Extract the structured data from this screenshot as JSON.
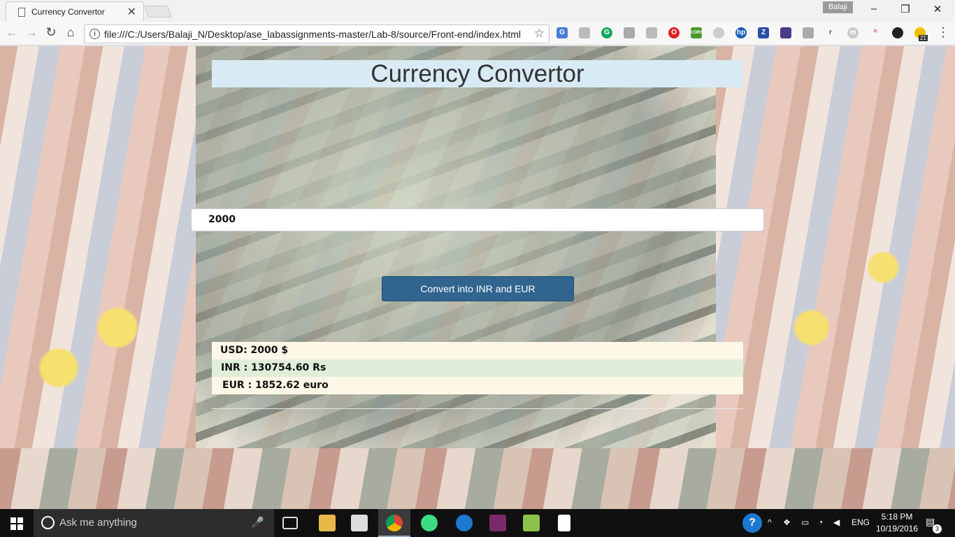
{
  "browser": {
    "tab_title": "Currency Convertor",
    "tab_close": "✕",
    "user_name": "Balaji",
    "url": "file:///C:/Users/Balaji_N/Desktop/ase_labassignments-master/Lab-8/source/Front-end/index.html"
  },
  "page": {
    "title": "Currency Convertor",
    "amount_value": "2000",
    "convert_button": "Convert into INR and EUR",
    "results": {
      "usd": "USD: 2000 $",
      "inr": "INR : 130754.60 Rs",
      "eur": "EUR : 1852.62 euro"
    }
  },
  "taskbar": {
    "search_placeholder": "Ask me anything",
    "language": "ENG",
    "time": "5:18 PM",
    "date": "10/19/2016",
    "notification_count": "3",
    "extension_badge": "21"
  }
}
